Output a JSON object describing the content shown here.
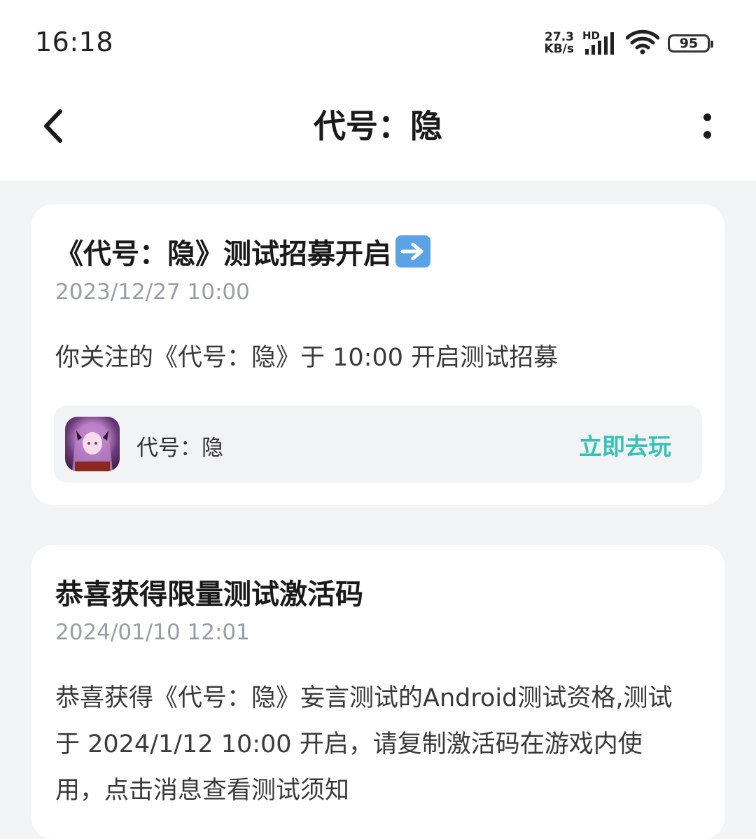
{
  "status": {
    "time": "16:18",
    "net_speed_value": "27.3",
    "net_speed_unit": "KB/s",
    "hd": "HD",
    "battery": "95"
  },
  "header": {
    "title": "代号：隐",
    "back_icon": "chevron-left-icon",
    "more_icon": "more-vertical-icon"
  },
  "messages": [
    {
      "title": "《代号：隐》测试招募开启",
      "title_emoji": "right-arrow-emoji",
      "date": "2023/12/27 10:00",
      "body": "你关注的《代号：隐》于 10:00 开启测试招募",
      "game": {
        "name": "代号：隐",
        "action": "立即去玩"
      }
    },
    {
      "title": "恭喜获得限量测试激活码",
      "date": "2024/01/10 12:01",
      "body": "恭喜获得《代号：隐》妄言测试的Android测试资格,测试于 2024/1/12 10:00 开启，请复制激活码在游戏内使用，点击消息查看测试须知"
    }
  ],
  "colors": {
    "accent": "#34c2b6",
    "background": "#f3f4f6",
    "card": "#ffffff",
    "date": "#9a9da3"
  }
}
